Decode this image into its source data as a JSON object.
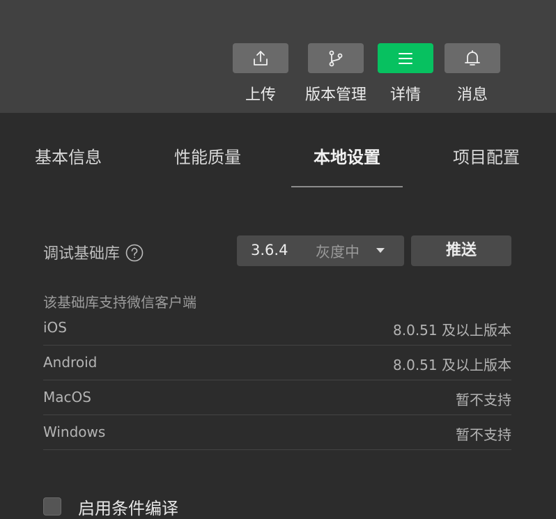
{
  "toolbar": {
    "upload_label": "上传",
    "version_label": "版本管理",
    "details_label": "详情",
    "messages_label": "消息",
    "accent_color": "#07c160"
  },
  "tabs": [
    {
      "label": "基本信息"
    },
    {
      "label": "性能质量"
    },
    {
      "label": "本地设置",
      "active": true
    },
    {
      "label": "项目配置"
    }
  ],
  "debug_lib": {
    "label": "调试基础库",
    "version": "3.6.4",
    "status": "灰度中",
    "push_label": "推送"
  },
  "support": {
    "title": "该基础库支持微信客户端",
    "platforms": [
      {
        "name": "iOS",
        "value": "8.0.51 及以上版本"
      },
      {
        "name": "Android",
        "value": "8.0.51 及以上版本"
      },
      {
        "name": "MacOS",
        "value": "暂不支持"
      },
      {
        "name": "Windows",
        "value": "暂不支持"
      }
    ]
  },
  "conditional_compile": {
    "label": "启用条件编译",
    "checked": false
  }
}
